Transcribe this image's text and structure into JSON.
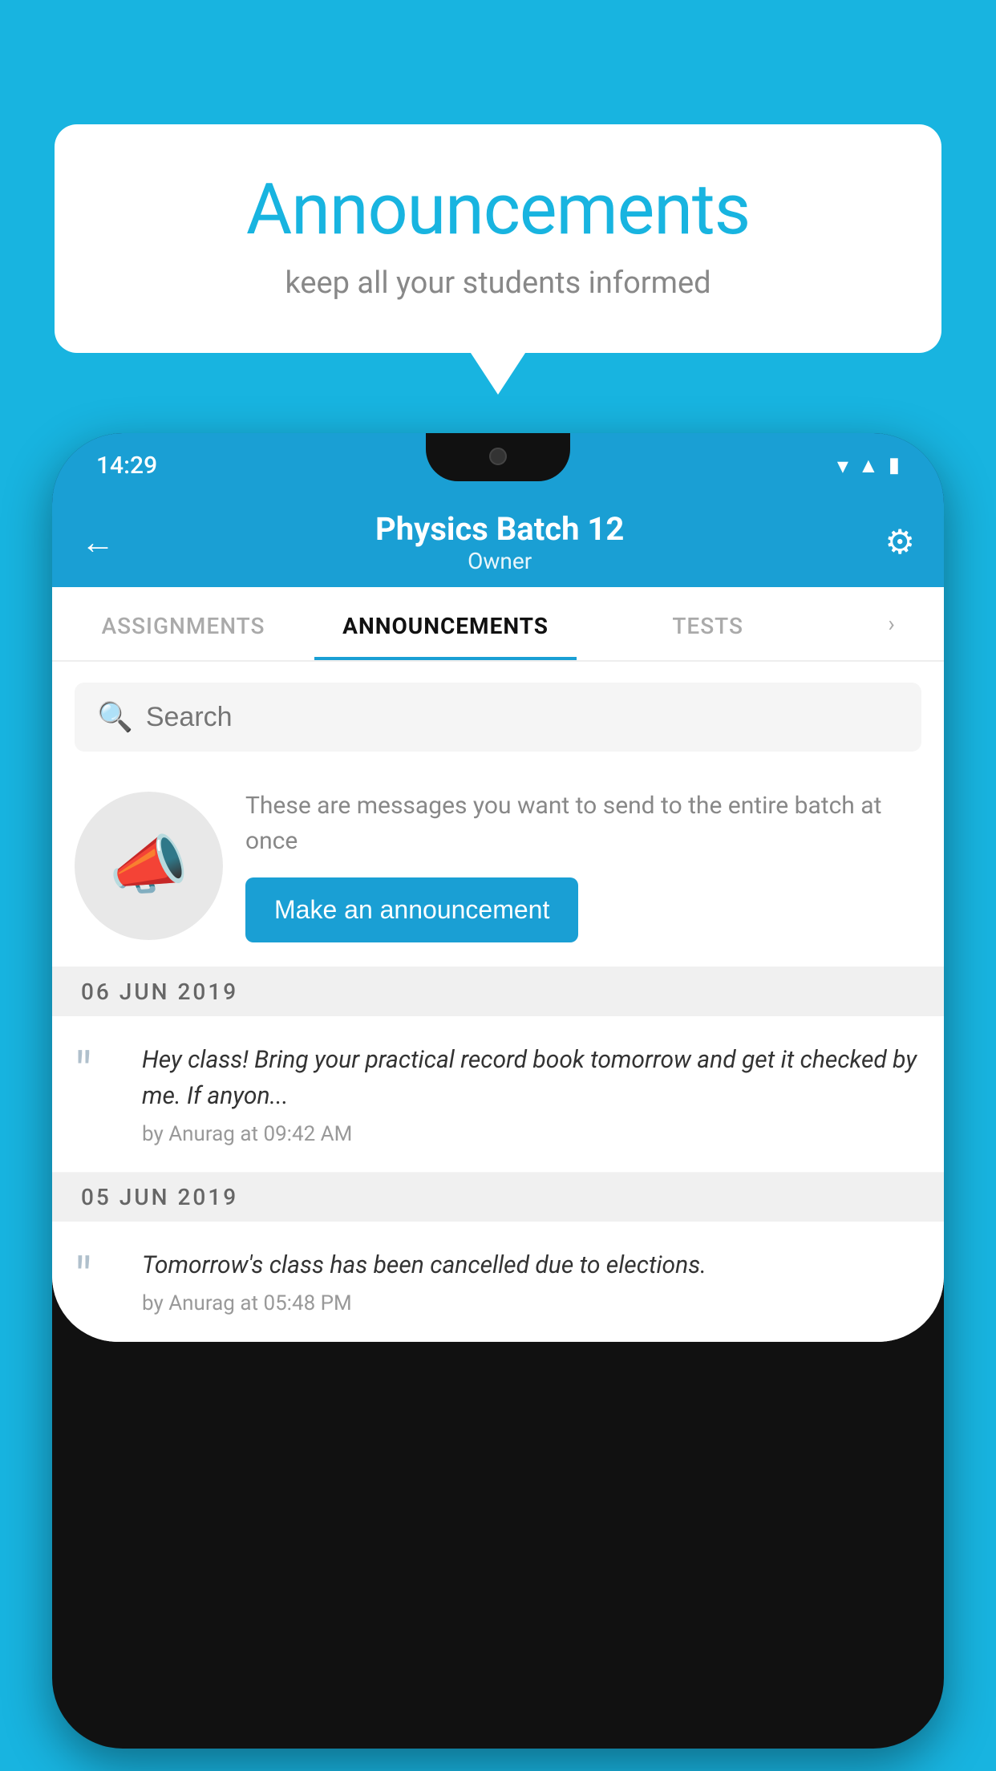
{
  "background_color": "#18b4e0",
  "speech_bubble": {
    "title": "Announcements",
    "subtitle": "keep all your students informed"
  },
  "phone": {
    "status_bar": {
      "time": "14:29",
      "icons": {
        "wifi": "▾",
        "signal": "▲",
        "battery": "▮"
      }
    },
    "header": {
      "title": "Physics Batch 12",
      "subtitle": "Owner",
      "back_label": "←",
      "settings_label": "⚙"
    },
    "tabs": [
      {
        "label": "ASSIGNMENTS",
        "active": false
      },
      {
        "label": "ANNOUNCEMENTS",
        "active": true
      },
      {
        "label": "TESTS",
        "active": false
      }
    ],
    "search": {
      "placeholder": "Search"
    },
    "announce_promo": {
      "description": "These are messages you want to send to the entire batch at once",
      "button_label": "Make an announcement"
    },
    "announcements": [
      {
        "date": "06  JUN  2019",
        "text": "Hey class! Bring your practical record book tomorrow and get it checked by me. If anyon...",
        "meta": "by Anurag at 09:42 AM"
      },
      {
        "date": "05  JUN  2019",
        "text": "Tomorrow's class has been cancelled due to elections.",
        "meta": "by Anurag at 05:48 PM"
      }
    ]
  }
}
